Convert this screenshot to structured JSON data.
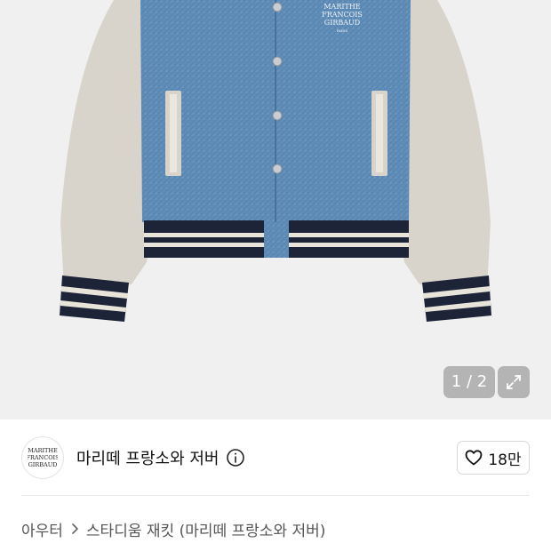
{
  "gallery": {
    "pager_text": "1 / 2",
    "jacket_brand_text": [
      "MARITHE",
      "FRANCOIS",
      "GIRBAUD"
    ],
    "jacket_brand_city": "PARIS"
  },
  "brand": {
    "name": "마리떼 프랑소와 저버",
    "logo_text": [
      "MARITHE",
      "FRANCOIS",
      "GIRBAUD"
    ]
  },
  "like": {
    "count": "18만"
  },
  "breadcrumb": {
    "category": "아우터",
    "product": "스타디움 재킷 (마리떼 프랑소와 저버)"
  },
  "colors": {
    "gallery_bg": "#f0f0f0",
    "denim": "#5f8db8",
    "sleeve": "#d9d4cb",
    "stripe_navy": "#1d2438"
  }
}
